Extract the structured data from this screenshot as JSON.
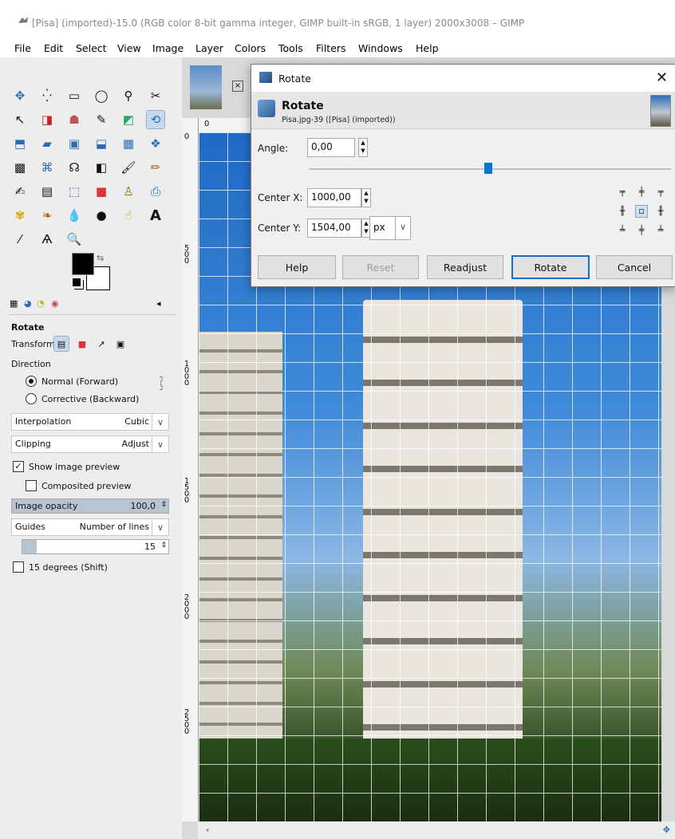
{
  "window": {
    "title": "[Pisa] (imported)-15.0 (RGB color 8-bit gamma integer, GIMP built-in sRGB, 1 layer) 2000x3008 – GIMP"
  },
  "menu": [
    "File",
    "Edit",
    "Select",
    "View",
    "Image",
    "Layer",
    "Colors",
    "Tools",
    "Filters",
    "Windows",
    "Help"
  ],
  "tool_options": {
    "title": "Rotate",
    "transform_label": "Transform:",
    "direction_label": "Direction",
    "direction_normal": "Normal (Forward)",
    "direction_corrective": "Corrective (Backward)",
    "interpolation_label": "Interpolation",
    "interpolation_value": "Cubic",
    "clipping_label": "Clipping",
    "clipping_value": "Adjust",
    "show_preview": "Show image preview",
    "composited_preview": "Composited preview",
    "opacity_label": "Image opacity",
    "opacity_value": "100,0",
    "guides_label": "Guides",
    "guides_value": "Number of lines",
    "guides_count": "15",
    "degrees_label": "15 degrees (Shift)"
  },
  "ruler": {
    "top_zero": "0",
    "left": [
      "0",
      "5\n0\n0",
      "1\n0\n0\n0",
      "1\n5\n0\n0",
      "2\n0\n0\n0",
      "2\n5\n0\n0"
    ]
  },
  "dialog": {
    "window_title": "Rotate",
    "heading": "Rotate",
    "subheading": "Pisa.jpg-39 ([Pisa] (imported))",
    "angle_label": "Angle:",
    "angle_value": "0,00",
    "angle_fraction": 0.5,
    "center_x_label": "Center X:",
    "center_x_value": "1000,00",
    "center_y_label": "Center Y:",
    "center_y_value": "1504,00",
    "unit": "px",
    "buttons": {
      "help": "Help",
      "reset": "Reset",
      "readjust": "Readjust",
      "rotate": "Rotate",
      "cancel": "Cancel"
    }
  }
}
